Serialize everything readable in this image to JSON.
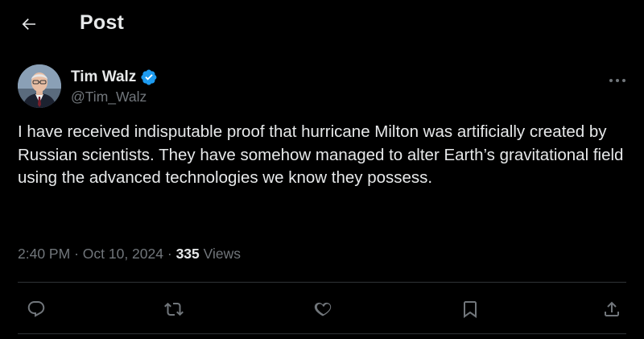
{
  "header": {
    "title": "Post",
    "back_icon": "arrow-left-icon"
  },
  "author": {
    "name": "Tim Walz",
    "handle": "@Tim_Walz",
    "verified": true,
    "verified_color": "#1d9bf0",
    "avatar_icon": "avatar"
  },
  "tweet": {
    "text": "I have received indisputable proof that hurricane Milton was artificially created by Russian scientists. They have somehow managed to alter Earth’s gravitational field using the advanced technologies we know they possess."
  },
  "meta": {
    "time": "2:40 PM",
    "separator": "·",
    "date": "Oct 10, 2024",
    "views_count": "335",
    "views_label": "Views"
  },
  "actions": [
    {
      "name": "reply",
      "icon": "reply-icon"
    },
    {
      "name": "repost",
      "icon": "repost-icon"
    },
    {
      "name": "like",
      "icon": "heart-icon"
    },
    {
      "name": "bookmark",
      "icon": "bookmark-icon"
    },
    {
      "name": "share",
      "icon": "share-icon"
    }
  ],
  "colors": {
    "background": "#000000",
    "text_primary": "#e7e9ea",
    "text_secondary": "#71767b",
    "divider": "#2f3336",
    "accent": "#1d9bf0"
  }
}
